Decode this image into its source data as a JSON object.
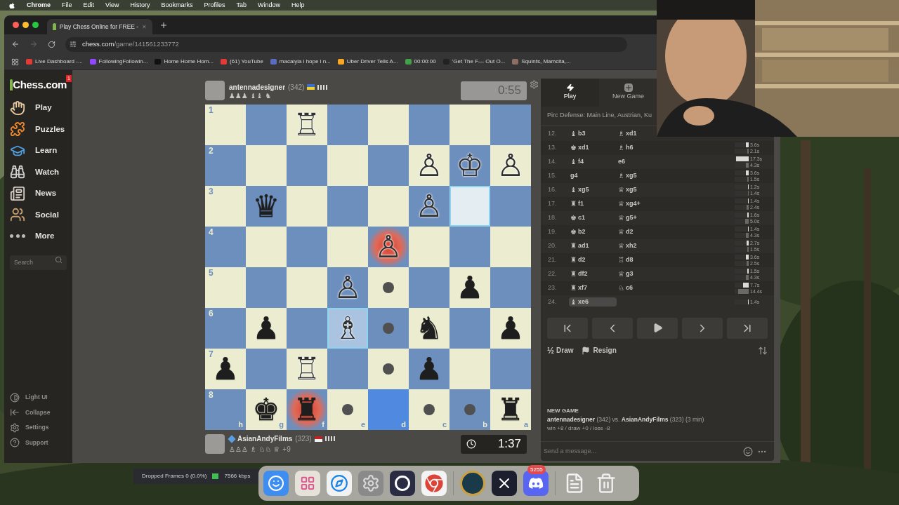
{
  "menu_bar": {
    "app": "Chrome",
    "items": [
      "File",
      "Edit",
      "View",
      "History",
      "Bookmarks",
      "Profiles",
      "Tab",
      "Window",
      "Help"
    ]
  },
  "browser": {
    "tab_title": "Play Chess Online for FREE -",
    "url_domain": "chess.com",
    "url_path": "/game/141561233772",
    "bookmarks": [
      {
        "label": "Live Dashboard -...",
        "color": "#e53935"
      },
      {
        "label": "FollowingFollowin...",
        "color": "#9146ff"
      },
      {
        "label": "Home Home Hom...",
        "color": "#111111"
      },
      {
        "label": "(61) YouTube",
        "color": "#e53935"
      },
      {
        "label": "macaiyla i hope i n...",
        "color": "#5c6bc0"
      },
      {
        "label": "Uber Driver Tells A...",
        "color": "#f9a825"
      },
      {
        "label": "00:00:00",
        "color": "#43a047"
      },
      {
        "label": "'Get The F— Out O...",
        "color": "#222222"
      },
      {
        "label": "Squints, Mamcita,...",
        "color": "#8d6e63"
      }
    ]
  },
  "sidebar": {
    "logo": "Chess.com",
    "logo_badge": "1",
    "items": [
      {
        "label": "Play",
        "kind": "play"
      },
      {
        "label": "Puzzles",
        "kind": "puzzles"
      },
      {
        "label": "Learn",
        "kind": "learn"
      },
      {
        "label": "Watch",
        "kind": "watch"
      },
      {
        "label": "News",
        "kind": "news"
      },
      {
        "label": "Social",
        "kind": "social"
      },
      {
        "label": "More",
        "kind": "more"
      }
    ],
    "search": {
      "placeholder": "Search"
    },
    "footer": [
      {
        "label": "Light UI",
        "kind": "theme"
      },
      {
        "label": "Collapse",
        "kind": "collapse"
      },
      {
        "label": "Settings",
        "kind": "settings"
      },
      {
        "label": "Support",
        "kind": "support"
      }
    ]
  },
  "top_player": {
    "name": "antennadesigner",
    "rating": "(342)",
    "captured": "♟♟♟ ♝♝ ♞",
    "clock": "0:55",
    "active": false
  },
  "bottom_player": {
    "name": "AsianAndyFilms",
    "rating": "(323)",
    "captured": "♙♙♙ ♗ ♘♘ ♕",
    "advantage": "+9",
    "clock": "1:37",
    "active": true
  },
  "board": {
    "rank_labels": [
      "1",
      "2",
      "3",
      "4",
      "5",
      "6",
      "7",
      "8"
    ],
    "file_labels": [
      "h",
      "g",
      "f",
      "e",
      "d",
      "c",
      "b",
      "a"
    ],
    "rows": [
      [
        {
          "kind": "empty",
          "selected": false,
          "highlighted": false,
          "attacked": false,
          "dot": false
        },
        {
          "kind": "empty",
          "selected": false,
          "highlighted": false,
          "attacked": false,
          "dot": false
        },
        {
          "kind": "white",
          "piece": "♖",
          "selected": false,
          "highlighted": false,
          "attacked": false,
          "dot": false
        },
        {
          "kind": "empty",
          "selected": false,
          "highlighted": false,
          "attacked": false,
          "dot": false
        },
        {
          "kind": "empty",
          "selected": false,
          "highlighted": false,
          "attacked": false,
          "dot": false
        },
        {
          "kind": "empty",
          "selected": false,
          "highlighted": false,
          "attacked": false,
          "dot": false
        },
        {
          "kind": "empty",
          "selected": false,
          "highlighted": false,
          "attacked": false,
          "dot": false
        },
        {
          "kind": "empty",
          "selected": false,
          "highlighted": false,
          "attacked": false,
          "dot": false
        }
      ],
      [
        {
          "kind": "empty",
          "selected": false,
          "highlighted": false,
          "attacked": false,
          "dot": false
        },
        {
          "kind": "empty",
          "selected": false,
          "highlighted": false,
          "attacked": false,
          "dot": false
        },
        {
          "kind": "empty",
          "selected": false,
          "highlighted": false,
          "attacked": false,
          "dot": false
        },
        {
          "kind": "empty",
          "selected": false,
          "highlighted": false,
          "attacked": false,
          "dot": false
        },
        {
          "kind": "empty",
          "selected": false,
          "highlighted": false,
          "attacked": false,
          "dot": false
        },
        {
          "kind": "white",
          "piece": "♙",
          "selected": false,
          "highlighted": false,
          "attacked": false,
          "dot": false
        },
        {
          "kind": "white",
          "piece": "♔",
          "selected": false,
          "highlighted": false,
          "attacked": false,
          "dot": false
        },
        {
          "kind": "white",
          "piece": "♙",
          "selected": false,
          "highlighted": false,
          "attacked": false,
          "dot": false
        }
      ],
      [
        {
          "kind": "empty",
          "selected": false,
          "highlighted": false,
          "attacked": false,
          "dot": false
        },
        {
          "kind": "black",
          "piece": "♛",
          "selected": false,
          "highlighted": false,
          "attacked": false,
          "dot": false
        },
        {
          "kind": "empty",
          "selected": false,
          "highlighted": false,
          "attacked": false,
          "dot": false
        },
        {
          "kind": "empty",
          "selected": false,
          "highlighted": false,
          "attacked": false,
          "dot": false
        },
        {
          "kind": "empty",
          "selected": false,
          "highlighted": false,
          "attacked": false,
          "dot": false
        },
        {
          "kind": "white",
          "piece": "♙",
          "selected": false,
          "highlighted": false,
          "attacked": false,
          "dot": false
        },
        {
          "kind": "empty",
          "selected": false,
          "highlighted": true,
          "attacked": false,
          "dot": false
        },
        {
          "kind": "empty",
          "selected": false,
          "highlighted": false,
          "attacked": false,
          "dot": false
        }
      ],
      [
        {
          "kind": "empty",
          "selected": false,
          "highlighted": false,
          "attacked": false,
          "dot": false
        },
        {
          "kind": "empty",
          "selected": false,
          "highlighted": false,
          "attacked": false,
          "dot": false
        },
        {
          "kind": "empty",
          "selected": false,
          "highlighted": false,
          "attacked": false,
          "dot": false
        },
        {
          "kind": "empty",
          "selected": false,
          "highlighted": false,
          "attacked": false,
          "dot": false
        },
        {
          "kind": "white",
          "piece": "♙",
          "selected": false,
          "highlighted": false,
          "attacked": true,
          "dot": false
        },
        {
          "kind": "empty",
          "selected": false,
          "highlighted": false,
          "attacked": false,
          "dot": false
        },
        {
          "kind": "empty",
          "selected": false,
          "highlighted": false,
          "attacked": false,
          "dot": false
        },
        {
          "kind": "empty",
          "selected": false,
          "highlighted": false,
          "attacked": false,
          "dot": false
        }
      ],
      [
        {
          "kind": "empty",
          "selected": false,
          "highlighted": false,
          "attacked": false,
          "dot": false
        },
        {
          "kind": "empty",
          "selected": false,
          "highlighted": false,
          "attacked": false,
          "dot": false
        },
        {
          "kind": "empty",
          "selected": false,
          "highlighted": false,
          "attacked": false,
          "dot": false
        },
        {
          "kind": "white",
          "piece": "♙",
          "selected": false,
          "highlighted": false,
          "attacked": false,
          "dot": false
        },
        {
          "kind": "empty",
          "selected": false,
          "highlighted": false,
          "attacked": false,
          "dot": true
        },
        {
          "kind": "empty",
          "selected": false,
          "highlighted": false,
          "attacked": false,
          "dot": false
        },
        {
          "kind": "black",
          "piece": "♟",
          "selected": false,
          "highlighted": false,
          "attacked": false,
          "dot": false
        },
        {
          "kind": "empty",
          "selected": false,
          "highlighted": false,
          "attacked": false,
          "dot": false
        }
      ],
      [
        {
          "kind": "empty",
          "selected": false,
          "highlighted": false,
          "attacked": false,
          "dot": false
        },
        {
          "kind": "black",
          "piece": "♟",
          "selected": false,
          "highlighted": false,
          "attacked": false,
          "dot": false
        },
        {
          "kind": "empty",
          "selected": false,
          "highlighted": false,
          "attacked": false,
          "dot": false
        },
        {
          "kind": "white",
          "piece": "♗",
          "selected": true,
          "highlighted": false,
          "attacked": false,
          "dot": false
        },
        {
          "kind": "empty",
          "selected": false,
          "highlighted": false,
          "attacked": false,
          "dot": true
        },
        {
          "kind": "black",
          "piece": "♞",
          "selected": false,
          "highlighted": false,
          "attacked": false,
          "dot": false
        },
        {
          "kind": "empty",
          "selected": false,
          "highlighted": false,
          "attacked": false,
          "dot": false
        },
        {
          "kind": "black",
          "piece": "♟",
          "selected": false,
          "highlighted": false,
          "attacked": false,
          "dot": false
        }
      ],
      [
        {
          "kind": "black",
          "piece": "♟",
          "selected": false,
          "highlighted": false,
          "attacked": false,
          "dot": false
        },
        {
          "kind": "empty",
          "selected": false,
          "highlighted": false,
          "attacked": false,
          "dot": false
        },
        {
          "kind": "white",
          "piece": "♖",
          "selected": false,
          "highlighted": false,
          "attacked": false,
          "dot": false
        },
        {
          "kind": "empty",
          "selected": false,
          "highlighted": false,
          "attacked": false,
          "dot": false
        },
        {
          "kind": "empty",
          "selected": false,
          "highlighted": false,
          "attacked": false,
          "dot": true
        },
        {
          "kind": "black",
          "piece": "♟",
          "selected": false,
          "highlighted": false,
          "attacked": false,
          "dot": false
        },
        {
          "kind": "empty",
          "selected": false,
          "highlighted": false,
          "attacked": false,
          "dot": false
        },
        {
          "kind": "empty",
          "selected": false,
          "highlighted": false,
          "attacked": false,
          "dot": false
        }
      ],
      [
        {
          "kind": "empty",
          "selected": false,
          "highlighted": false,
          "attacked": false,
          "dot": false
        },
        {
          "kind": "black",
          "piece": "♚",
          "selected": false,
          "highlighted": false,
          "attacked": false,
          "dot": false
        },
        {
          "kind": "black",
          "piece": "♜",
          "selected": false,
          "highlighted": false,
          "attacked": true,
          "dot": false
        },
        {
          "kind": "empty",
          "selected": false,
          "highlighted": false,
          "attacked": false,
          "dot": true
        },
        {
          "kind": "empty",
          "selected": false,
          "highlighted": true,
          "attacked": false,
          "dot": false
        },
        {
          "kind": "empty",
          "selected": false,
          "highlighted": false,
          "attacked": false,
          "dot": true
        },
        {
          "kind": "empty",
          "selected": false,
          "highlighted": false,
          "attacked": false,
          "dot": true
        },
        {
          "kind": "black",
          "piece": "♜",
          "selected": false,
          "highlighted": false,
          "attacked": false,
          "dot": false
        }
      ]
    ]
  },
  "panel": {
    "tabs": [
      {
        "label": "Play",
        "kind": "play",
        "selected": true
      },
      {
        "label": "New Game",
        "kind": "new",
        "selected": false
      }
    ],
    "opening": "Pirc Defense: Main Line, Austrian, Ku",
    "moves": [
      {
        "number": "12.",
        "white": {
          "piece": "♝",
          "san": "b3",
          "selected": false
        },
        "black": {
          "piece": "♗",
          "san": "xd1",
          "selected": false
        }
      },
      {
        "number": "13.",
        "white": {
          "piece": "♚",
          "san": "xd1",
          "selected": false
        },
        "black": {
          "piece": "♗",
          "san": "h6",
          "selected": false
        },
        "times": [
          {
            "text": "3.6s",
            "level": 0.21
          },
          {
            "text": "2.1s",
            "level": 0.12
          }
        ]
      },
      {
        "number": "14.",
        "white": {
          "piece": "♝",
          "san": "f4",
          "selected": false
        },
        "black": {
          "san": "e6",
          "selected": false
        },
        "times": [
          {
            "text": "17.3s",
            "level": 1
          },
          {
            "text": "4.3s",
            "level": 0.25
          }
        ]
      },
      {
        "number": "15.",
        "white": {
          "san": "g4",
          "selected": false
        },
        "black": {
          "piece": "♗",
          "san": "xg5",
          "selected": false
        },
        "times": [
          {
            "text": "3.6s",
            "level": 0.21
          },
          {
            "text": "1.5s",
            "level": 0.09
          }
        ]
      },
      {
        "number": "16.",
        "white": {
          "piece": "♝",
          "san": "xg5",
          "selected": false
        },
        "black": {
          "piece": "♕",
          "san": "xg5",
          "selected": false
        },
        "times": [
          {
            "text": "1.2s",
            "level": 0.07
          },
          {
            "text": "1.4s",
            "level": 0.08
          }
        ]
      },
      {
        "number": "17.",
        "white": {
          "piece": "♜",
          "san": "f1",
          "selected": false
        },
        "black": {
          "piece": "♕",
          "san": "xg4+",
          "selected": false
        },
        "times": [
          {
            "text": "1.4s",
            "level": 0.08
          },
          {
            "text": "2.4s",
            "level": 0.14
          }
        ]
      },
      {
        "number": "18.",
        "white": {
          "piece": "♚",
          "san": "c1",
          "selected": false
        },
        "black": {
          "piece": "♕",
          "san": "g5+",
          "selected": false
        },
        "times": [
          {
            "text": "1.6s",
            "level": 0.09
          },
          {
            "text": "5.0s",
            "level": 0.29
          }
        ]
      },
      {
        "number": "19.",
        "white": {
          "piece": "♚",
          "san": "b2",
          "selected": false
        },
        "black": {
          "piece": "♕",
          "san": "d2",
          "selected": false
        },
        "times": [
          {
            "text": "1.4s",
            "level": 0.08
          },
          {
            "text": "4.3s",
            "level": 0.25
          }
        ]
      },
      {
        "number": "20.",
        "white": {
          "piece": "♜",
          "san": "ad1",
          "selected": false
        },
        "black": {
          "piece": "♕",
          "san": "xh2",
          "selected": false
        },
        "times": [
          {
            "text": "2.7s",
            "level": 0.16
          },
          {
            "text": "1.5s",
            "level": 0.09
          }
        ]
      },
      {
        "number": "21.",
        "white": {
          "piece": "♜",
          "san": "d2",
          "selected": false
        },
        "black": {
          "piece": "♖",
          "san": "d8",
          "selected": false
        },
        "times": [
          {
            "text": "3.6s",
            "level": 0.21
          },
          {
            "text": "2.5s",
            "level": 0.14
          }
        ]
      },
      {
        "number": "22.",
        "white": {
          "piece": "♜",
          "san": "df2",
          "selected": false
        },
        "black": {
          "piece": "♕",
          "san": "g3",
          "selected": false
        },
        "times": [
          {
            "text": "1.5s",
            "level": 0.09
          },
          {
            "text": "4.3s",
            "level": 0.25
          }
        ]
      },
      {
        "number": "23.",
        "white": {
          "piece": "♜",
          "san": "xf7",
          "selected": false
        },
        "black": {
          "piece": "♘",
          "san": "c6",
          "selected": false
        },
        "times": [
          {
            "text": "7.7s",
            "level": 0.45
          },
          {
            "text": "14.4s",
            "level": 0.83
          }
        ]
      },
      {
        "number": "24.",
        "white": {
          "piece": "♝",
          "san": "xe6",
          "selected": true
        },
        "times": [
          {
            "text": "1.4s",
            "level": 0.08
          }
        ]
      }
    ],
    "draw_symbol": "½",
    "draw": "Draw",
    "resign": "Resign",
    "chat": {
      "heading": "NEW GAME",
      "line": "**antennadesigner** (342) vs. **AsianAndyFilms** (323) (3 min)",
      "result": "win +8 / draw +0 / lose -8",
      "placeholder": "Send a message..."
    }
  },
  "obs": {
    "dropped": "Dropped Frames 0 (0.0%)",
    "bitrate": "7566 kbps"
  },
  "dock": {
    "discord_badge": "5255"
  }
}
